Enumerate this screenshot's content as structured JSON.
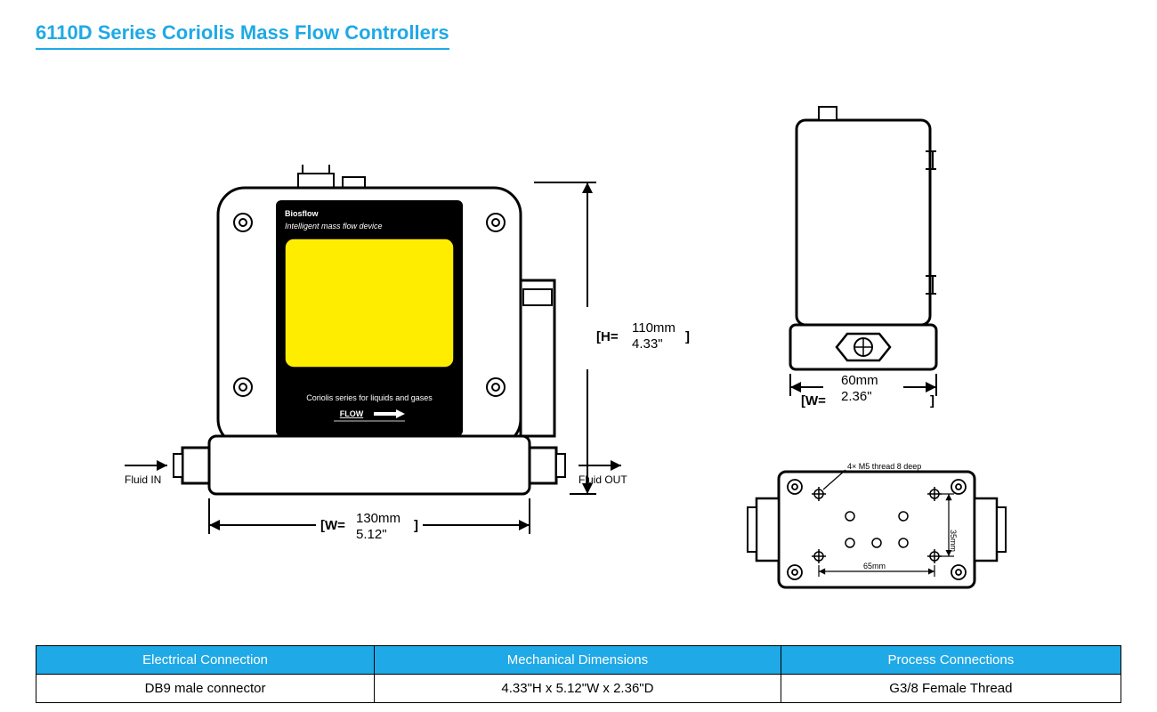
{
  "title": "6110D Series Coriolis Mass Flow Controllers",
  "front": {
    "brand": "Biosflow",
    "tagline": "Intelligent mass flow device",
    "series": "Coriolis  series for liquids and gases",
    "flow": "FLOW",
    "fluid_in": "Fluid IN",
    "fluid_out": "Fluid OUT",
    "width_top_mm": "130mm",
    "width_top_in": "5.12\"",
    "height_mm": "110mm",
    "height_in": "4.33\"",
    "w_prefix": "[W=",
    "w_suffix": "]",
    "h_prefix": "[H=",
    "h_suffix": "]"
  },
  "side": {
    "width_mm": "60mm",
    "width_in": "2.36\"",
    "w_prefix": "[W=",
    "w_suffix": "]"
  },
  "bottom": {
    "thread_note": "4× M5 thread 8 deep",
    "dim1": "65mm",
    "dim2": "35mm"
  },
  "table": {
    "h1": "Electrical Connection",
    "h2": "Mechanical Dimensions",
    "h3": "Process Connections",
    "v1": "DB9 male connector",
    "v2": "4.33\"H x 5.12\"W x 2.36\"D",
    "v3": "G3/8 Female Thread"
  }
}
